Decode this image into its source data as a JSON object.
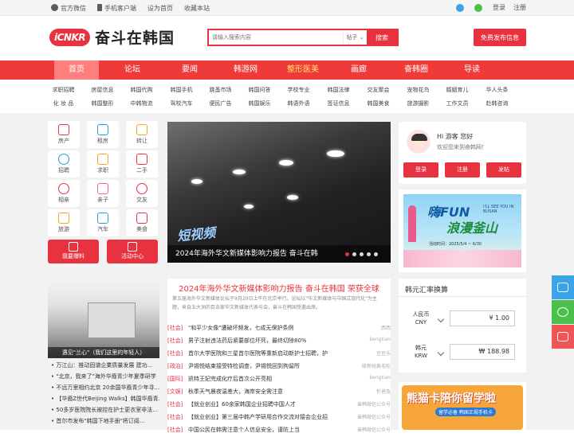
{
  "topbar": {
    "left_links": [
      "官方微信",
      "手机客户端",
      "设为首页",
      "收藏本站"
    ],
    "login": "登录",
    "register": "注册"
  },
  "header": {
    "logo_badge": "iCNKR",
    "logo_text": "奋斗在韩国",
    "search_placeholder": "请输入搜索内容",
    "search_type": "帖子",
    "search_button": "搜索",
    "free_post": "免费发布信息"
  },
  "nav": {
    "items": [
      "首页",
      "论坛",
      "要闻",
      "韩游网",
      "整形医美",
      "画廊",
      "奋韩圈",
      "导读"
    ]
  },
  "subnav": {
    "row1": [
      "求职招聘",
      "房屋信息",
      "韩国代购",
      "韩国手机",
      "跳蚤市场",
      "韩国问答",
      "学校专业",
      "韩国法律",
      "交友聚会",
      "宠物花鸟",
      "婚姻育儿",
      "华人头条"
    ],
    "row2": [
      "化 妆 品",
      "韩国整形",
      "中韩物流",
      "驾校汽车",
      "便民广告",
      "韩国娱乐",
      "韩语外语",
      "签证信息",
      "韩国美食",
      "旅游摄影",
      "工作文员",
      "赴韩咨询"
    ]
  },
  "quick": {
    "items": [
      "房产",
      "租房",
      "转让",
      "招聘",
      "求职",
      "二手",
      "相亲",
      "亲子",
      "交友",
      "旅游",
      "汽车",
      "美食"
    ],
    "btn_report": "我要爆料",
    "btn_event": "活动中心"
  },
  "slider": {
    "video_tag": "短视频",
    "caption": "2024年海外华文新媒体影响力报告 奋斗在韩",
    "dots": 5,
    "active_dot": 0
  },
  "user": {
    "greet": "Hi 游客 您好",
    "welcome": "欢迎您来到奋韩网！",
    "login": "登录",
    "register": "注册",
    "post": "发帖"
  },
  "banner": {
    "title1": "嗨FUN",
    "title2": "浪漫釜山",
    "small": "I'LL SEE YOU IN BUSAN",
    "date": "活动时间：2025/5/4 ~ 6/30"
  },
  "news": {
    "image_caption": "遇见\"兰心\"（我们这里的年轻人）",
    "headline": "2024年海外华文新媒体影响力报告  奋斗在韩国 荣获全球",
    "summary": "第五届海外华文新媒体论坛于9月20日上午在北京举行。论坛以\"华文新媒体与中国式现代化\"为主题，来自五大洲的百余家华文新媒体代表与会，奋斗在韩国受邀出席。",
    "items": [
      {
        "cat": "[社会]",
        "title": "\"和平少女像\"遭破坏频发，七成无保护条例",
        "src": "西西"
      },
      {
        "cat": "[社会]",
        "title": "男子注射违法药后紧要部位坏死，最终切除80%",
        "src": "bengtian"
      },
      {
        "cat": "[社会]",
        "title": "首尔大学医院和三星首尔医院等重新启动新护士招聘，护",
        "src": "豆豆乐"
      },
      {
        "cat": "[政治]",
        "title": "尹锡悦结束接受特检调查，尹锡悦回到拘留所",
        "src": "绫新碰鼻毛吃"
      },
      {
        "cat": "[国际]",
        "title": "凯特王妃完成化疗后首次公开亮相",
        "src": "bengtian"
      },
      {
        "cat": "[文娱]",
        "title": "秋季天气晨夜温差大，海岸安全需注意",
        "src": "忻爸兔"
      },
      {
        "cat": "[社会]",
        "title": "【就业创业】60余家韩国企业招聘中国人才",
        "src": "奋韩微信公众号"
      },
      {
        "cat": "[社会]",
        "title": "【就业创业】第三届中韩产学研用合作交流对接会企业招",
        "src": "奋韩微信公众号"
      },
      {
        "cat": "[社会]",
        "title": "中国公民在韩需注意个人信息安全，谨防上当",
        "src": "奋韩微信公众号"
      }
    ],
    "left_list": [
      "万江山：推动固谱企業质量发展 建功...",
      "\"北京，我来了\"海外华裔青少年夏季研学",
      "不远万里相约北京 20余国华裔青少年寻...",
      "【华裔Z世代Beijing Walks】韩国华裔青...",
      "50多岁医院院长被控在护士更衣室非法...",
      "首尔市发布\"韩国下地手册\"将订阅..."
    ]
  },
  "forex": {
    "title": "韩元汇率换算",
    "cny_name": "人民币",
    "cny_code": "CNY",
    "cny_value": "¥ 1.00",
    "krw_name": "韩元",
    "krw_code": "KRW",
    "krw_value": "₩ 188.98"
  },
  "promo": {
    "title": "熊猫卡陪你留学啦",
    "sub": "留学必备 韩国正规手机卡"
  },
  "colors": {
    "brand_red": "#e8323f",
    "nav_red": "#f03a3a",
    "side_blue": "#3ba3e8",
    "side_green": "#4bc14b",
    "side_red": "#f05454"
  }
}
